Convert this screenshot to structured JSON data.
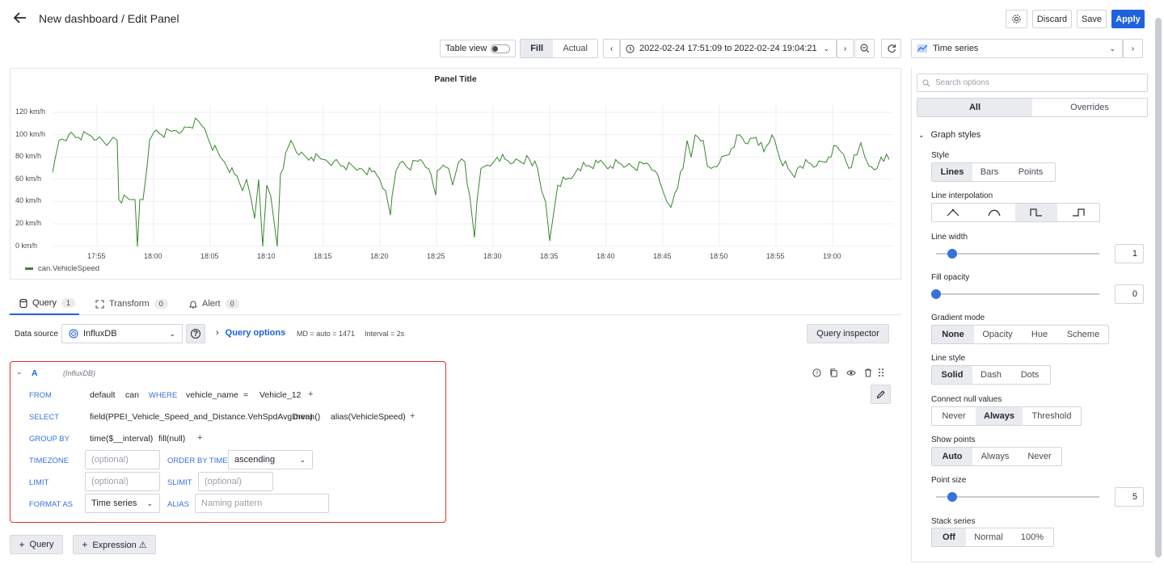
{
  "header": {
    "title": "New dashboard / Edit Panel",
    "discard_label": "Discard",
    "save_label": "Save",
    "apply_label": "Apply"
  },
  "toolbar": {
    "table_view_label": "Table view",
    "fill_label": "Fill",
    "actual_label": "Actual",
    "time_range": "2022-02-24 17:51:09 to 2022-02-24 19:04:21",
    "visualization": "Time series"
  },
  "panel": {
    "title": "Panel Title",
    "y_ticks": [
      "120 km/h",
      "100 km/h",
      "80 km/h",
      "60 km/h",
      "40 km/h",
      "20 km/h",
      "0 km/h"
    ],
    "x_ticks": [
      "17:55",
      "18:00",
      "18:05",
      "18:10",
      "18:15",
      "18:20",
      "18:25",
      "18:30",
      "18:35",
      "18:40",
      "18:45",
      "18:50",
      "18:55",
      "19:00"
    ],
    "legend": "can.VehicleSpeed",
    "line_color": "#37872d"
  },
  "tabs": [
    {
      "label": "Query",
      "count": "1"
    },
    {
      "label": "Transform",
      "count": "0"
    },
    {
      "label": "Alert",
      "count": "0"
    }
  ],
  "datasource": {
    "label": "Data source",
    "value": "InfluxDB",
    "query_options": "Query options",
    "md": "MD = auto = 1471",
    "interval": "Interval = 2s",
    "inspector": "Query inspector"
  },
  "query": {
    "letter": "A",
    "source": "(InfluxDB)",
    "from_kw": "FROM",
    "from_policy": "default",
    "from_measurement": "can",
    "where_kw": "WHERE",
    "where_key": "vehicle_name",
    "where_op": "=",
    "where_value": "Vehicle_12",
    "select_kw": "SELECT",
    "select_field": "field(PPEI_Vehicle_Speed_and_Distance.VehSpdAvgDrvn)",
    "select_fn": "mean()",
    "select_alias": "alias(VehicleSpeed)",
    "groupby_kw": "GROUP BY",
    "groupby_time": "time($__interval)",
    "groupby_fill": "fill(null)",
    "timezone_kw": "TIMEZONE",
    "optional": "(optional)",
    "orderby_kw": "ORDER BY TIME",
    "orderby_value": "ascending",
    "limit_kw": "LIMIT",
    "slimit_kw": "SLIMIT",
    "formatas_kw": "FORMAT AS",
    "formatas_value": "Time series",
    "alias_kw": "ALIAS",
    "alias_placeholder": "Naming pattern",
    "plus": "+"
  },
  "bottom": {
    "add_query": "Query",
    "add_expression": "Expression ⚠"
  },
  "options": {
    "search_placeholder": "Search options",
    "all_tab": "All",
    "overrides_tab": "Overrides",
    "section": "Graph styles",
    "style_label": "Style",
    "style_options": [
      "Lines",
      "Bars",
      "Points"
    ],
    "interp_label": "Line interpolation",
    "width_label": "Line width",
    "width_value": "1",
    "fill_label": "Fill opacity",
    "fill_value": "0",
    "gradient_label": "Gradient mode",
    "gradient_options": [
      "None",
      "Opacity",
      "Hue",
      "Scheme"
    ],
    "linestyle_label": "Line style",
    "linestyle_options": [
      "Solid",
      "Dash",
      "Dots"
    ],
    "connect_label": "Connect null values",
    "connect_options": [
      "Never",
      "Always",
      "Threshold"
    ],
    "points_label": "Show points",
    "points_options": [
      "Auto",
      "Always",
      "Never"
    ],
    "pointsize_label": "Point size",
    "pointsize_value": "5",
    "stack_label": "Stack series",
    "stack_options": [
      "Off",
      "Normal",
      "100%"
    ]
  }
}
